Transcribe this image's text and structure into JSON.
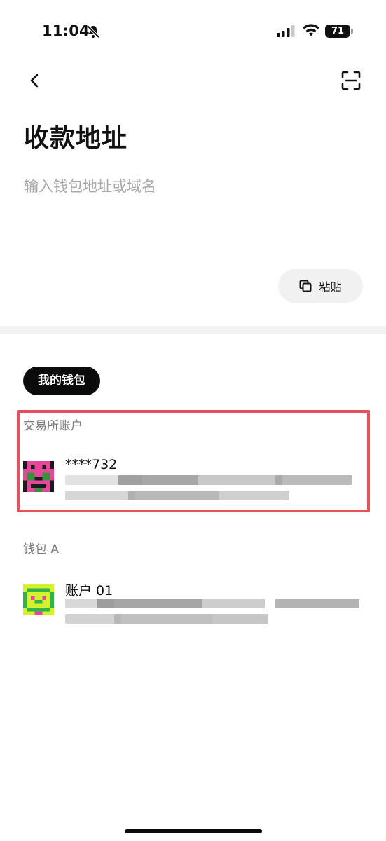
{
  "status_bar": {
    "time": "11:04",
    "battery_level": "71",
    "icons": [
      "bell-slash-icon",
      "signal-icon",
      "wifi-icon",
      "battery-icon"
    ]
  },
  "header": {
    "back_icon": "chevron-left-icon",
    "scan_icon": "scan-icon"
  },
  "page": {
    "title": "收款地址"
  },
  "address_input": {
    "placeholder": "输入钱包地址或域名",
    "value": ""
  },
  "paste_button": {
    "label": "粘贴",
    "icon": "copy-icon"
  },
  "tabs": {
    "my_wallet": "我的钱包"
  },
  "groups": [
    {
      "label": "交易所账户",
      "accounts": [
        {
          "name": "****732",
          "avatar_colors": [
            "#e7479b",
            "#1a1a1a",
            "#3c8f3c"
          ]
        }
      ]
    },
    {
      "label": "钱包 A",
      "accounts": [
        {
          "name": "账户 01",
          "avatar_colors": [
            "#d4f22c",
            "#2fb34a",
            "#e7479b"
          ]
        }
      ]
    }
  ],
  "colors": {
    "accent_dark": "#0b0b0b",
    "highlight_border": "#e8505b",
    "muted_text": "#7a7a7a"
  }
}
